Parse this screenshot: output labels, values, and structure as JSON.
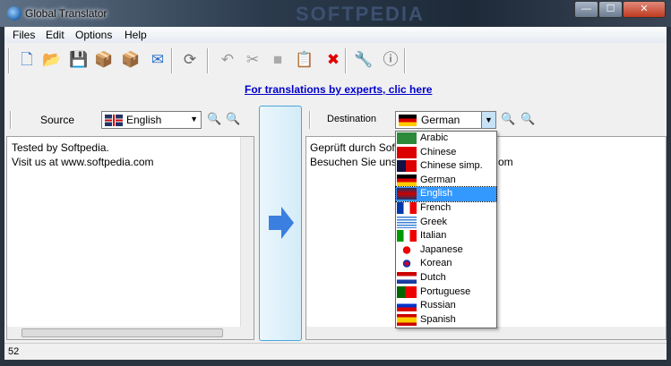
{
  "window": {
    "title": "Global Translator",
    "watermark": "SOFTPEDIA",
    "minimize": "—",
    "maximize": "☐",
    "close": "✕"
  },
  "menu": [
    "Files",
    "Edit",
    "Options",
    "Help"
  ],
  "toolbar": [
    {
      "name": "new-icon",
      "glyph": "🗋",
      "color": "#2a6fc9"
    },
    {
      "name": "open-icon",
      "glyph": "📂",
      "color": "#3a7fd0"
    },
    {
      "name": "save-icon",
      "glyph": "💾",
      "color": "#1e5fb8"
    },
    {
      "name": "import-icon",
      "glyph": "📦",
      "color": "#2a6fc9"
    },
    {
      "name": "export-icon",
      "glyph": "📦",
      "color": "#2a6fc9"
    },
    {
      "name": "mail-icon",
      "glyph": "✉",
      "color": "#2a6fc9"
    },
    {
      "name": "swap-icon",
      "glyph": "⟳",
      "color": "#666"
    },
    {
      "name": "undo-icon",
      "glyph": "↶",
      "color": "#999"
    },
    {
      "name": "cut-icon",
      "glyph": "✂",
      "color": "#999"
    },
    {
      "name": "copy-icon",
      "glyph": "■",
      "color": "#aaa"
    },
    {
      "name": "paste-icon",
      "glyph": "📋",
      "color": "#d9a400"
    },
    {
      "name": "delete-icon",
      "glyph": "✖",
      "color": "#e00000"
    },
    {
      "name": "settings-icon",
      "glyph": "🔧",
      "color": "#777"
    },
    {
      "name": "info-icon",
      "glyph": "ⓘ",
      "color": "#555"
    }
  ],
  "link": "For translations by experts, clic here",
  "source": {
    "label": "Source",
    "language": "English",
    "text": [
      "Tested by Softpedia.",
      "Visit us at www.softpedia.com"
    ]
  },
  "destination": {
    "label": "Destination",
    "language": "German",
    "text": [
      "Geprüft durch Soft",
      "Besuchen Sie uns",
      "om"
    ]
  },
  "dropdown": {
    "selected": "English",
    "items": [
      {
        "label": "Arabic",
        "flag": "linear-gradient(#2a8a3a,#2a8a3a)"
      },
      {
        "label": "Chinese",
        "flag": "linear-gradient(#d00,#d00)"
      },
      {
        "label": "Chinese simp.",
        "flag": "linear-gradient(90deg,#114 0 45%,#d00 45%)"
      },
      {
        "label": "German",
        "flag": "linear-gradient(#000 0 33%,#d00 33% 66%,#fc0 66%)"
      },
      {
        "label": "English",
        "flag": "linear-gradient(#236,#c00,#236)"
      },
      {
        "label": "French",
        "flag": "linear-gradient(90deg,#0038a8 0 33%,#fff 33% 66%,#e00 66%)"
      },
      {
        "label": "Greek",
        "flag": "repeating-linear-gradient(#3b7fd4 0 1.5px,#fff 1.5px 3px)"
      },
      {
        "label": "Italian",
        "flag": "linear-gradient(90deg,#090 0 33%,#fff 33% 66%,#e00 66%)"
      },
      {
        "label": "Japanese",
        "flag": "radial-gradient(circle,#e00 0 32%,#fff 34%)"
      },
      {
        "label": "Korean",
        "flag": "radial-gradient(circle,#c03 0 20%,#03a 22% 32%,#fff 34%)"
      },
      {
        "label": "Dutch",
        "flag": "linear-gradient(#c00 0 33%,#fff 33% 66%,#1a3ca0 66%)"
      },
      {
        "label": "Portuguese",
        "flag": "linear-gradient(90deg,#060 0 40%,#e00 40%)"
      },
      {
        "label": "Russian",
        "flag": "linear-gradient(#fff 0 33%,#03c 33% 66%,#d00 66%)"
      },
      {
        "label": "Spanish",
        "flag": "linear-gradient(#c00 0 25%,#fc0 25% 75%,#c00 75%)"
      }
    ]
  },
  "status": "52"
}
